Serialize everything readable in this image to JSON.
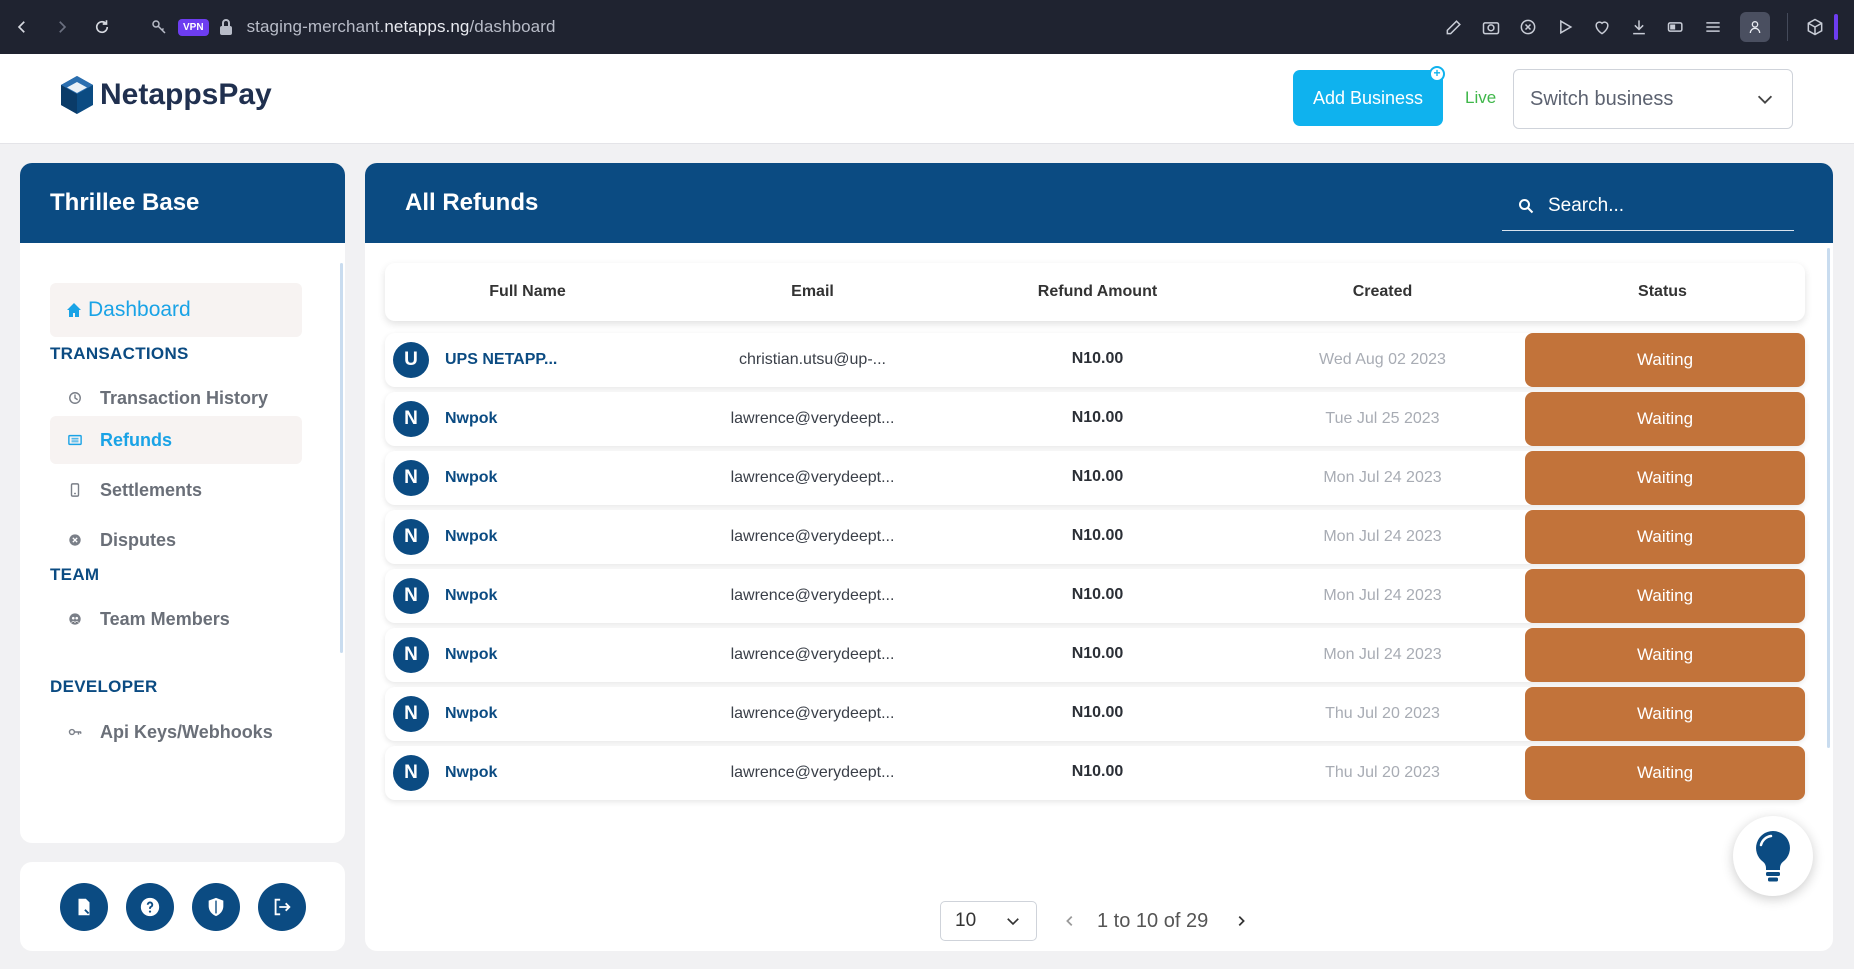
{
  "browser": {
    "vpn_label": "VPN",
    "url_prefix": "staging-merchant.",
    "url_domain": "netapps.ng",
    "url_path": "/dashboard"
  },
  "header": {
    "logo_text": "NetappsPay",
    "add_business_label": "Add Business",
    "live_label": "Live",
    "switch_business_label": "Switch business"
  },
  "sidebar": {
    "business_name": "Thrillee Base",
    "dashboard_label": "Dashboard",
    "sections": {
      "transactions": "TRANSACTIONS",
      "team": "TEAM",
      "developer": "DEVELOPER"
    },
    "items": {
      "transaction_history": "Transaction History",
      "refunds": "Refunds",
      "settlements": "Settlements",
      "disputes": "Disputes",
      "team_members": "Team Members",
      "api_keys": "Api Keys/Webhooks"
    }
  },
  "main": {
    "title": "All Refunds",
    "search_placeholder": "Search...",
    "columns": {
      "full_name": "Full Name",
      "email": "Email",
      "refund_amount": "Refund Amount",
      "created": "Created",
      "status": "Status"
    },
    "rows": [
      {
        "initial": "U",
        "name": "UPS NETAPP...",
        "email": "christian.utsu@up-...",
        "amount": "N10.00",
        "created": "Wed Aug 02 2023",
        "status": "Waiting"
      },
      {
        "initial": "N",
        "name": "Nwpok",
        "email": "lawrence@verydeept...",
        "amount": "N10.00",
        "created": "Tue Jul 25 2023",
        "status": "Waiting"
      },
      {
        "initial": "N",
        "name": "Nwpok",
        "email": "lawrence@verydeept...",
        "amount": "N10.00",
        "created": "Mon Jul 24 2023",
        "status": "Waiting"
      },
      {
        "initial": "N",
        "name": "Nwpok",
        "email": "lawrence@verydeept...",
        "amount": "N10.00",
        "created": "Mon Jul 24 2023",
        "status": "Waiting"
      },
      {
        "initial": "N",
        "name": "Nwpok",
        "email": "lawrence@verydeept...",
        "amount": "N10.00",
        "created": "Mon Jul 24 2023",
        "status": "Waiting"
      },
      {
        "initial": "N",
        "name": "Nwpok",
        "email": "lawrence@verydeept...",
        "amount": "N10.00",
        "created": "Mon Jul 24 2023",
        "status": "Waiting"
      },
      {
        "initial": "N",
        "name": "Nwpok",
        "email": "lawrence@verydeept...",
        "amount": "N10.00",
        "created": "Thu Jul 20 2023",
        "status": "Waiting"
      },
      {
        "initial": "N",
        "name": "Nwpok",
        "email": "lawrence@verydeept...",
        "amount": "N10.00",
        "created": "Thu Jul 20 2023",
        "status": "Waiting"
      }
    ],
    "pager": {
      "page_size": "10",
      "range_text": "1 to 10 of 29"
    }
  },
  "colors": {
    "primary": "#0b4b82",
    "accent": "#0fb2ee",
    "status_waiting": "#c2733a",
    "live": "#3fb74a"
  }
}
